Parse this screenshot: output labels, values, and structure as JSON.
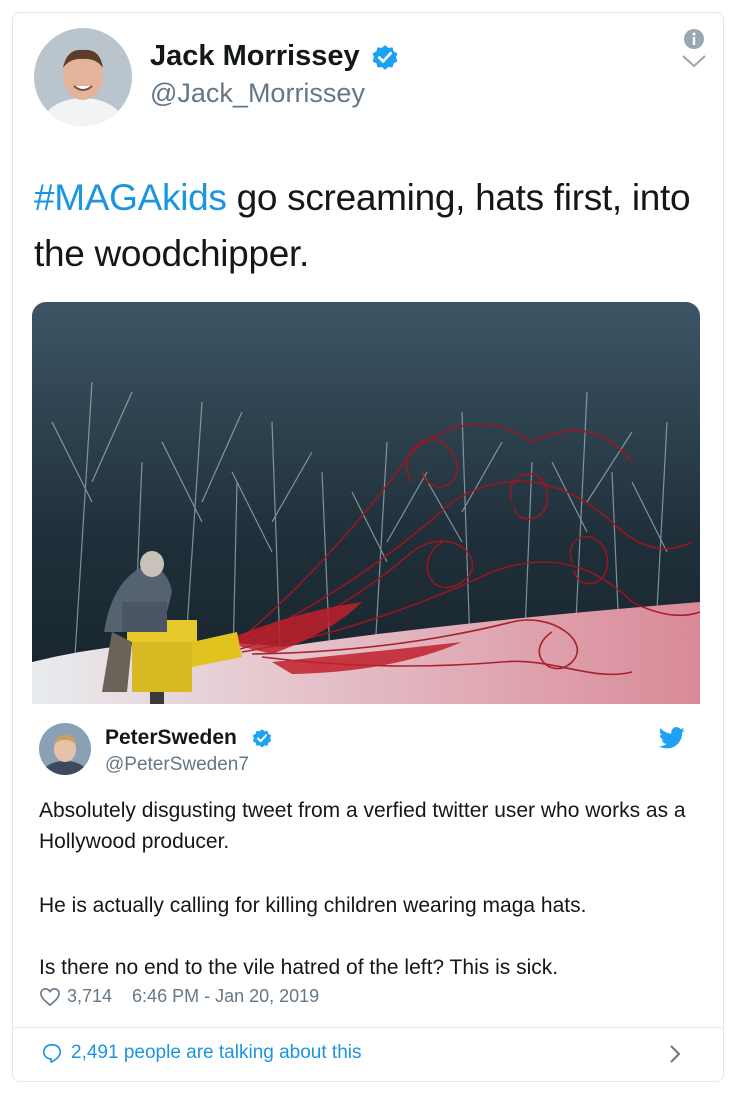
{
  "quoted_tweet": {
    "author_name": "Jack Morrissey",
    "author_handle": "@Jack_Morrissey",
    "hashtag": "#MAGAkids",
    "text_rest": " go screaming, hats first, into the woodchipper."
  },
  "embedded_tweet": {
    "author_name": "PeterSweden",
    "author_handle": "@PeterSweden7",
    "paragraph_1": "Absolutely disgusting tweet from a verfied twitter user who works as a Hollywood producer.",
    "paragraph_2": "He is actually calling for killing children wearing maga hats.",
    "paragraph_3": "Is there no end to the vile hatred of the left? This is sick.",
    "likes": "3,714",
    "timestamp": "6:46 PM - Jan 20, 2019",
    "talking": "2,491 people are talking about this"
  },
  "colors": {
    "accent": "#1b95e0",
    "text": "#14171a",
    "muted": "#657786",
    "verified": "#1da1f2"
  },
  "icons": [
    "info-icon",
    "chevron-down-icon",
    "verified-badge-icon",
    "twitter-bird-icon",
    "heart-icon",
    "reply-bubble-icon",
    "chevron-right-icon"
  ]
}
